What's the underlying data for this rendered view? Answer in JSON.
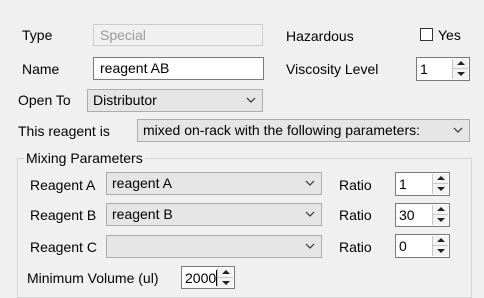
{
  "type": {
    "label": "Type",
    "value": "Special"
  },
  "hazardous": {
    "label": "Hazardous",
    "checkbox_label": "Yes",
    "checked": false
  },
  "name": {
    "label": "Name",
    "value": "reagent AB"
  },
  "viscosity": {
    "label": "Viscosity Level",
    "value": "1"
  },
  "open_to": {
    "label": "Open To",
    "value": "Distributor"
  },
  "reagent_mode": {
    "label": "This reagent is",
    "value": "mixed on-rack with the following parameters:"
  },
  "mixing": {
    "title": "Mixing Parameters",
    "rows": [
      {
        "label": "Reagent A",
        "value": "reagent A",
        "ratio_label": "Ratio",
        "ratio": "1"
      },
      {
        "label": "Reagent B",
        "value": "reagent B",
        "ratio_label": "Ratio",
        "ratio": "30"
      },
      {
        "label": "Reagent C",
        "value": "",
        "ratio_label": "Ratio",
        "ratio": "0"
      }
    ],
    "min_volume": {
      "label": "Minimum Volume (ul)",
      "value": "2000"
    }
  },
  "icons": {
    "dropdown": "chevron-down-icon",
    "spin_up": "triangle-up-icon",
    "spin_down": "triangle-down-icon"
  },
  "colors": {
    "window_bg": "#f0f0f0",
    "field_border": "#7a7a7a",
    "combo_bg": "#e5e5e5",
    "disabled_text": "#9a9a9a"
  }
}
